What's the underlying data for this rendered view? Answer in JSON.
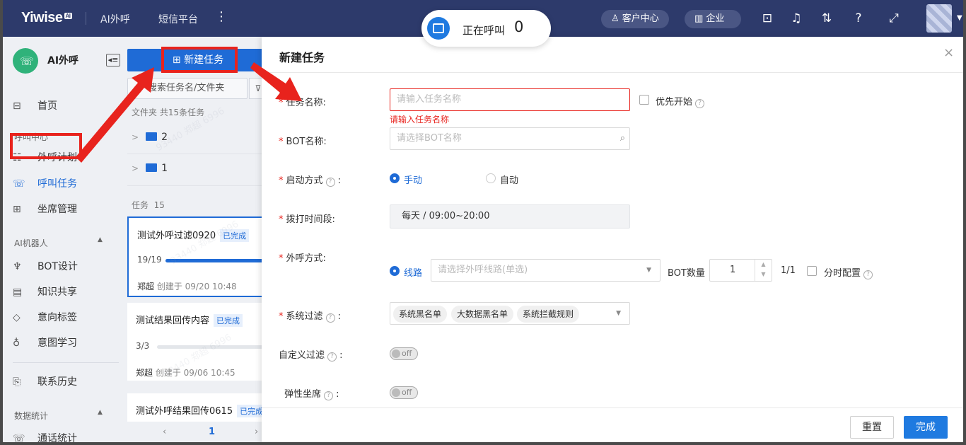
{
  "topbar": {
    "logo": "Yiwise",
    "logo_badge": "AI",
    "nav": [
      "AI外呼",
      "短信平台"
    ],
    "more": "⋮",
    "customer_center": "客户中心",
    "enterprise": "企业"
  },
  "calling": {
    "label": "正在呼叫",
    "count": "0"
  },
  "sidebar": {
    "brand": "AI外呼",
    "home": "首页",
    "sec_call": "呼叫中心",
    "plan": "外呼计划",
    "task": "呼叫任务",
    "seat": "坐席管理",
    "sec_robot": "AI机器人",
    "bot": "BOT设计",
    "knowledge": "知识共享",
    "intent_tag": "意向标签",
    "intent_learn": "意图学习",
    "history": "联系历史",
    "sec_stats": "数据统计",
    "call_stats": "通话统计"
  },
  "tasklist": {
    "new_button": "新建任务",
    "search_placeholder": "搜索任务名/文件夹",
    "folder_header": "文件夹",
    "folder_count": "共15条任务",
    "folders": [
      "2",
      "1"
    ],
    "task_header": "任务",
    "task_count": "15",
    "tasks": [
      {
        "name": "测试外呼过滤0920",
        "status": "已完成",
        "progress_text": "19/19",
        "progress": 1.0,
        "owner": "郑超",
        "created": "创建于 09/20 10:48"
      },
      {
        "name": "测试结果回传内容",
        "status": "已完成",
        "progress_text": "3/3",
        "progress": 0.0,
        "owner": "郑超",
        "created": "创建于 09/06 10:45"
      },
      {
        "name": "测试外呼结果回传0615",
        "status": "已完成"
      }
    ],
    "pager_prev": "‹",
    "pager_page": "1",
    "pager_next": "›",
    "watermark": "93440 郑超 6996"
  },
  "modal": {
    "title": "新建任务",
    "close": "×",
    "task_name_label": "任务名称:",
    "task_name_placeholder": "请输入任务名称",
    "task_name_error": "请输入任务名称",
    "priority_label": "优先开始",
    "bot_label": "BOT名称:",
    "bot_placeholder": "请选择BOT名称",
    "start_label": "启动方式",
    "start_manual": "手动",
    "start_auto": "自动",
    "time_label": "拨打时间段:",
    "time_value": "每天 / 09:00~20:00",
    "method_label": "外呼方式:",
    "method_line": "线路",
    "line_placeholder": "请选择外呼线路(单选)",
    "bot_count_label": "BOT数量",
    "bot_count_value": "1",
    "bot_count_ratio": "1/1",
    "time_config_label": "分时配置",
    "filter_label": "系统过滤",
    "filter_tags": [
      "系统黑名单",
      "大数据黑名单",
      "系统拦截规则"
    ],
    "custom_filter_label": "自定义过滤",
    "elastic_seat_label": "弹性坐席",
    "toggle_off": "off",
    "reset_button": "重置",
    "done_button": "完成"
  },
  "colors": {
    "primary": "#1f6bd6",
    "topbar": "#2d3a6b",
    "annotation": "#e8231d"
  }
}
